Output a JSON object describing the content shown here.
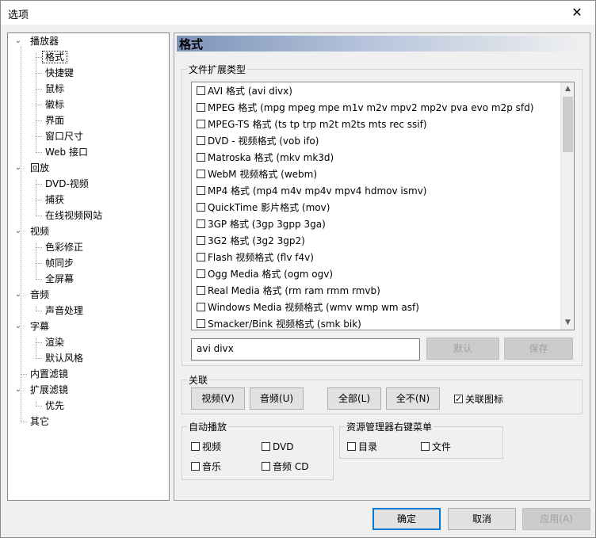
{
  "window": {
    "title": "选项",
    "close_glyph": "✕"
  },
  "tree": {
    "items": [
      {
        "label": "播放器",
        "expander": "⌄"
      },
      {
        "label": "格式"
      },
      {
        "label": "快捷键"
      },
      {
        "label": "鼠标"
      },
      {
        "label": "徽标"
      },
      {
        "label": "界面"
      },
      {
        "label": "窗口尺寸"
      },
      {
        "label": "Web 接口"
      },
      {
        "label": "回放",
        "expander": "⌄"
      },
      {
        "label": "DVD-视频"
      },
      {
        "label": "捕获"
      },
      {
        "label": "在线视频网站"
      },
      {
        "label": "视频",
        "expander": "⌄"
      },
      {
        "label": "色彩修正"
      },
      {
        "label": "帧同步"
      },
      {
        "label": "全屏幕"
      },
      {
        "label": "音频",
        "expander": "⌄"
      },
      {
        "label": "声音处理"
      },
      {
        "label": "字幕",
        "expander": "⌄"
      },
      {
        "label": "渲染"
      },
      {
        "label": "默认风格"
      },
      {
        "label": "内置滤镜"
      },
      {
        "label": "扩展滤镜",
        "expander": "⌄"
      },
      {
        "label": "优先"
      },
      {
        "label": "其它"
      }
    ]
  },
  "page": {
    "title": "格式"
  },
  "file_ext": {
    "group_title": "文件扩展类型",
    "items": [
      "AVI 格式 (avi divx)",
      "MPEG 格式 (mpg mpeg mpe m1v m2v mpv2 mp2v pva evo m2p sfd)",
      "MPEG-TS 格式 (ts tp trp m2t m2ts mts rec ssif)",
      "DVD - 视频格式 (vob ifo)",
      "Matroska 格式 (mkv mk3d)",
      "WebM 视频格式 (webm)",
      "MP4 格式 (mp4 m4v mp4v mpv4 hdmov ismv)",
      "QuickTime 影片格式 (mov)",
      "3GP 格式 (3gp 3gpp 3ga)",
      "3G2 格式 (3g2 3gp2)",
      "Flash 视频格式 (flv f4v)",
      "Ogg Media 格式 (ogm ogv)",
      "Real Media 格式 (rm ram rmm rmvb)",
      "Windows Media 视频格式 (wmv wmp wm asf)",
      "Smacker/Bink 视频格式 (smk bik)"
    ],
    "ext_value": "avi divx",
    "default_label": "默认",
    "save_label": "保存",
    "scroll_up": "▲",
    "scroll_down": "▼"
  },
  "assoc": {
    "group_title": "关联",
    "video_label": "视频(V)",
    "audio_label": "音频(U)",
    "all_label": "全部(L)",
    "none_label": "全不(N)",
    "icons_label": "关联图标"
  },
  "autoplay": {
    "group_title": "自动播放",
    "video": "视频",
    "dvd": "DVD",
    "music": "音乐",
    "audio_cd": "音频 CD"
  },
  "explorer": {
    "group_title": "资源管理器右键菜单",
    "directory": "目录",
    "file": "文件"
  },
  "footer": {
    "ok_label": "确定",
    "cancel_label": "取消",
    "apply_label": "应用(A)"
  }
}
